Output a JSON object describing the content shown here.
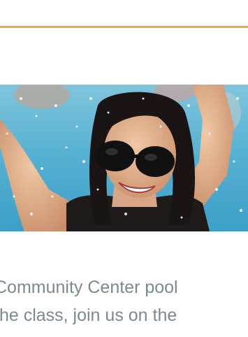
{
  "content": {
    "divider_color": "#e0ad4a",
    "hero_image": {
      "icon": "pool-swimmer-photo"
    },
    "paragraph": {
      "line1": " Community Center pool",
      "line2": "the class, join us on the"
    },
    "text_color": "#7a8a91"
  }
}
